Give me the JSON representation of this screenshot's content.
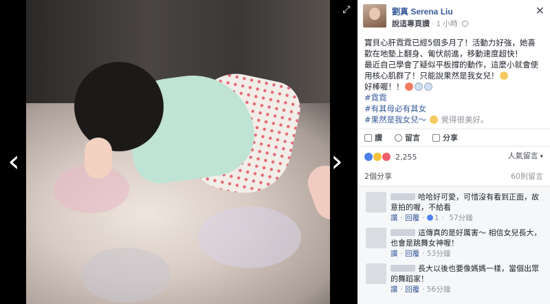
{
  "photo": {
    "nav_prev_icon": "chevron-left-icon",
    "nav_next_icon": "chevron-right-icon",
    "nav_prev_glyph": "‹",
    "nav_next_glyph": "›",
    "fullscreen_glyph": "⤢"
  },
  "post": {
    "page_name": "劉真 Serena Liu",
    "author": "說這專頁讚",
    "time": "1 小時",
    "close_glyph": "✕",
    "body_lines": [
      "寶貝心肝霓霓已經5個多月了！活動力好強，她喜歡在地墊上翻身、匍伏前進，移動速度超快！",
      "最近自己學會了疑似平板撐的動作，這麼小就會使用核心肌群了！只能說果然是我女兒！",
      "好棒喔！！"
    ],
    "hashtags": [
      "#霓霓",
      "#有其母必有其女",
      "#果然是我女兒～"
    ],
    "feeling": "覺得很美好。"
  },
  "actions": {
    "like": "讚",
    "comment": "留言",
    "share": "分享"
  },
  "reactions": {
    "count": "2,255",
    "top_comments": "人氣留言"
  },
  "share_row": {
    "shares": "2個分享",
    "comments_count": "60則留言"
  },
  "comments": [
    {
      "text": "哈哈好可愛，可惜沒有看到正面，故意拍的喔，不給看",
      "like": "讚",
      "reply": "回覆",
      "likes": "1",
      "time": "57分鐘"
    },
    {
      "text": "這傳真的是好厲害～ 相信女兒長大，也會是跳舞女神喔！",
      "like": "讚",
      "reply": "回覆",
      "likes": "",
      "time": "53分鐘"
    },
    {
      "text": "長大以後也要像媽媽一樣，當個出眾的舞蹈家！",
      "like": "讚",
      "reply": "回覆",
      "likes": "",
      "time": "56分鐘"
    }
  ]
}
